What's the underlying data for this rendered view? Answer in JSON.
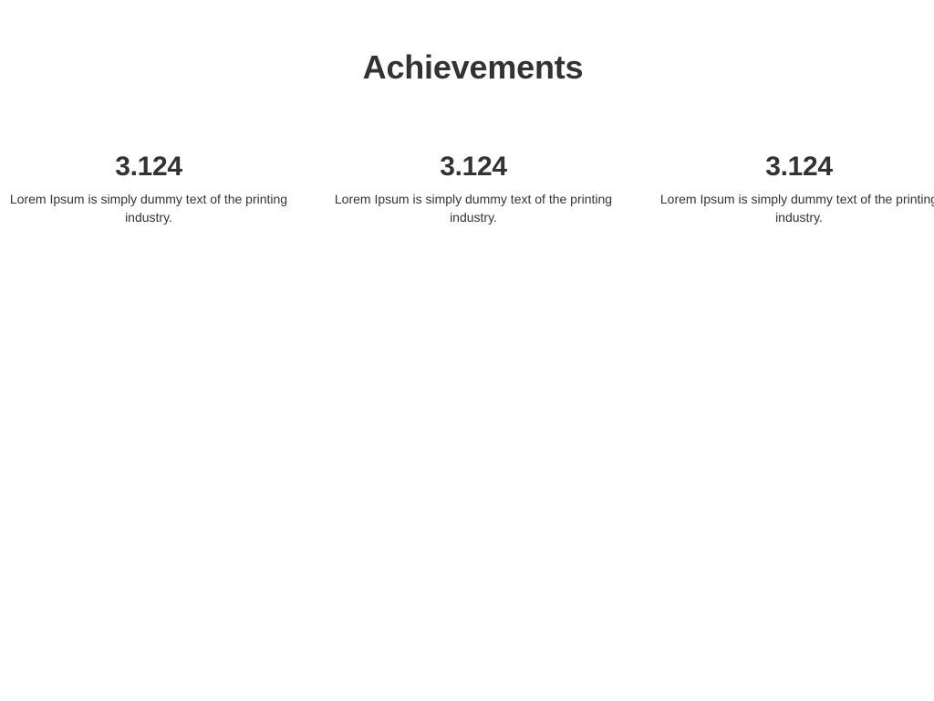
{
  "section": {
    "title": "Achievements"
  },
  "stats": [
    {
      "number": "3.124",
      "text": "Lorem Ipsum is simply dummy text of the printing industry."
    },
    {
      "number": "3.124",
      "text": "Lorem Ipsum is simply dummy text of the printing industry."
    },
    {
      "number": "3.124",
      "text": "Lorem Ipsum is simply dummy text of the printing industry."
    }
  ]
}
